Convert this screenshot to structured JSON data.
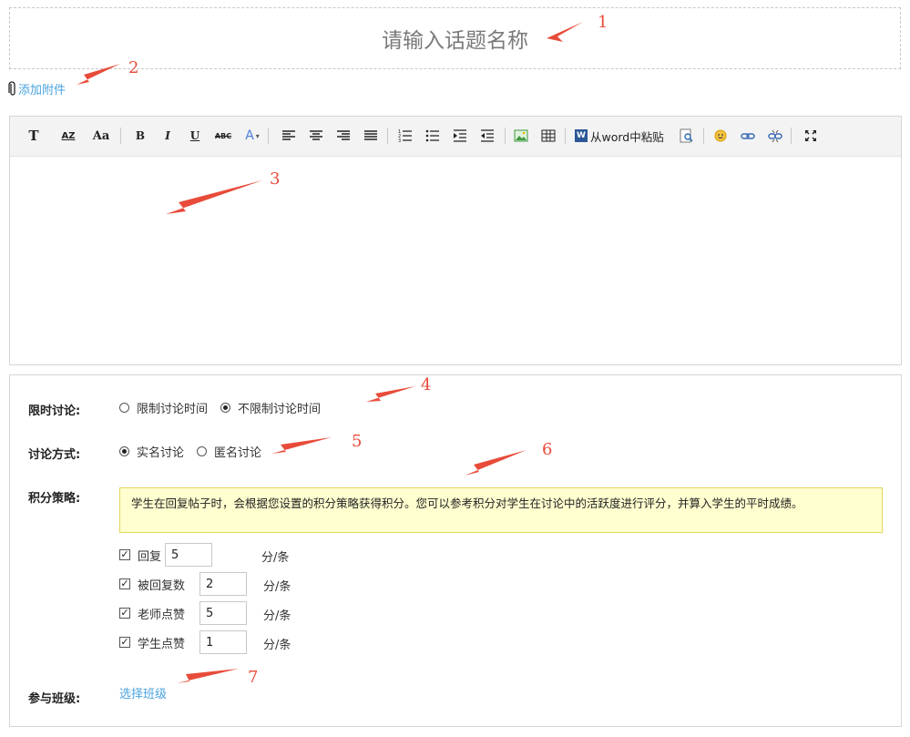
{
  "topic": {
    "placeholder": "请输入话题名称"
  },
  "attachment": {
    "label": "添加附件"
  },
  "toolbar": {
    "word_paste_label": "从word中粘贴",
    "font_size_label": "T",
    "sort_label": "AZ",
    "font_family_label": "Aa",
    "bold_label": "B",
    "italic_label": "I",
    "underline_label": "U",
    "strike_label": "ABC",
    "color_label": "A"
  },
  "settings": {
    "time_label": "限时讨论:",
    "time_options": [
      "限制讨论时间",
      "不限制讨论时间"
    ],
    "time_selected": 1,
    "mode_label": "讨论方式:",
    "mode_options": [
      "实名讨论",
      "匿名讨论"
    ],
    "mode_selected": 0,
    "score_label": "积分策略:",
    "score_notice": "学生在回复帖子时，会根据您设置的积分策略获得积分。您可以参考积分对学生在讨论中的活跃度进行评分，并算入学生的平时成绩。",
    "score_rules": [
      {
        "label": "回复",
        "value": "5",
        "unit": "分/条",
        "checked": true
      },
      {
        "label": "被回复数",
        "value": "2",
        "unit": "分/条",
        "checked": true
      },
      {
        "label": "老师点赞",
        "value": "5",
        "unit": "分/条",
        "checked": true
      },
      {
        "label": "学生点赞",
        "value": "1",
        "unit": "分/条",
        "checked": true
      }
    ],
    "class_label": "参与班级:",
    "choose_class_link": "选择班级"
  },
  "annotations": [
    "1",
    "2",
    "3",
    "4",
    "5",
    "6",
    "7"
  ],
  "colors": {
    "link": "#4aa3df",
    "annotation": "#e84b3a",
    "notice_bg": "#ffffcf"
  }
}
